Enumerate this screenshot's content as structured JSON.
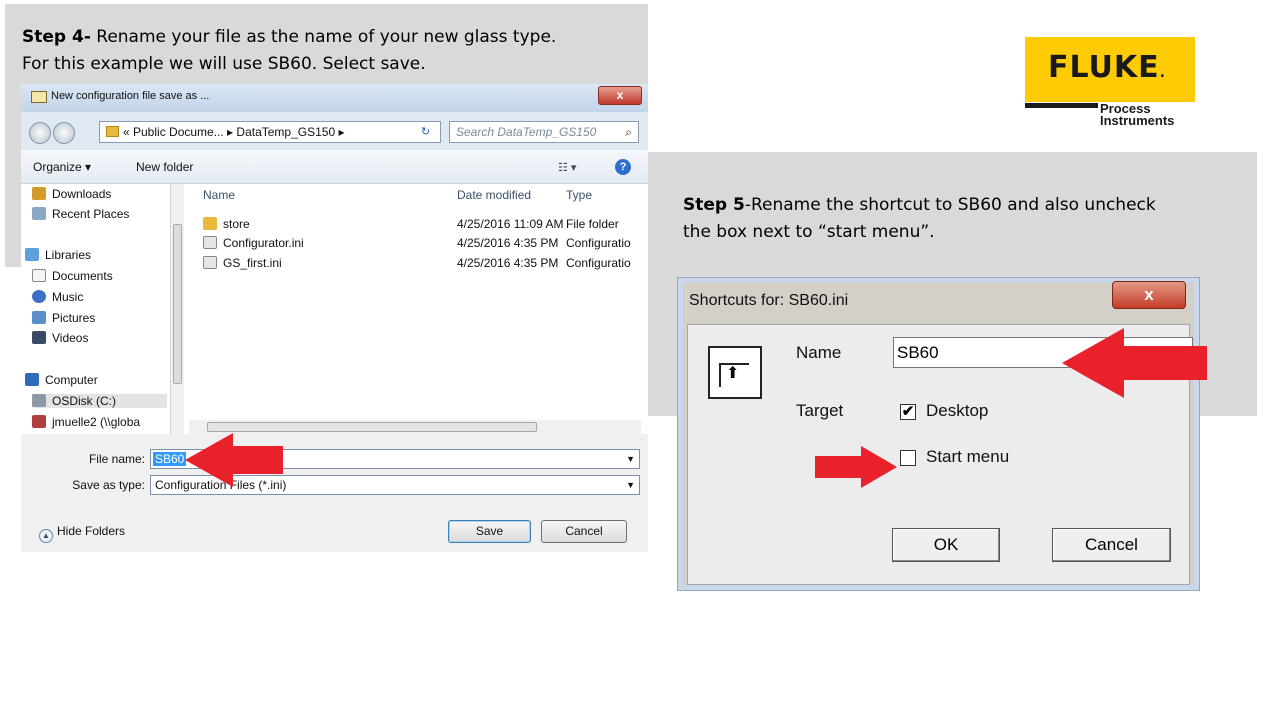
{
  "step4": {
    "label": "Step 4-",
    "line1_rest": " Rename your file as the name of your new glass type.",
    "line2": "For this example we will use SB60. Select save."
  },
  "step5": {
    "label": "Step 5",
    "line1_rest": "-Rename the shortcut to SB60 and also uncheck",
    "line2": "the box next to “start menu”."
  },
  "logo": {
    "word": "FLUKE",
    "dot": ".",
    "sub_line1": "Process",
    "sub_line2": "Instruments",
    "color_yellow": "#ffcb05"
  },
  "save_dialog": {
    "title": "New configuration file save as ...",
    "close": "x",
    "address": "« Public Docume... ▸ DataTemp_GS150 ▸",
    "search_placeholder": "Search DataTemp_GS150",
    "organize": "Organize ▾",
    "new_folder": "New folder",
    "help": "?",
    "nav_items": [
      {
        "label": "Downloads",
        "icon": "downloads-icon"
      },
      {
        "label": "Recent Places",
        "icon": "recent-places-icon"
      },
      {
        "label": "Libraries",
        "icon": "libraries-icon"
      },
      {
        "label": "Documents",
        "icon": "documents-icon"
      },
      {
        "label": "Music",
        "icon": "music-icon"
      },
      {
        "label": "Pictures",
        "icon": "pictures-icon"
      },
      {
        "label": "Videos",
        "icon": "videos-icon"
      },
      {
        "label": "Computer",
        "icon": "computer-icon"
      },
      {
        "label": "OSDisk (C:)",
        "icon": "disk-icon"
      },
      {
        "label": "jmuelle2 (\\\\globa",
        "icon": "network-drive-icon"
      }
    ],
    "columns": {
      "name": "Name",
      "date": "Date modified",
      "type": "Type"
    },
    "files": [
      {
        "name": "store",
        "date": "4/25/2016 11:09 AM",
        "type": "File folder",
        "icon": "folder-icon"
      },
      {
        "name": "Configurator.ini",
        "date": "4/25/2016 4:35 PM",
        "type": "Configuratio",
        "icon": "ini-file-icon"
      },
      {
        "name": "GS_first.ini",
        "date": "4/25/2016 4:35 PM",
        "type": "Configuratio",
        "icon": "ini-file-icon"
      }
    ],
    "file_name_label": "File name:",
    "file_name_value": "SB60",
    "save_type_label": "Save as type:",
    "save_type_value": "Configuration Files  (*.ini)",
    "hide_folders": "Hide Folders",
    "save_button": "Save",
    "cancel_button": "Cancel"
  },
  "shortcut_dialog": {
    "title": "Shortcuts for: SB60.ini",
    "close": "x",
    "name_label": "Name",
    "name_value": "SB60",
    "target_label": "Target",
    "desktop_label": "Desktop",
    "desktop_checked": "✔",
    "start_menu_label": "Start menu",
    "ok_button": "OK",
    "cancel_button": "Cancel"
  },
  "colors": {
    "arrow_red": "#e8212b",
    "slide_gray": "#d9d9d9"
  }
}
